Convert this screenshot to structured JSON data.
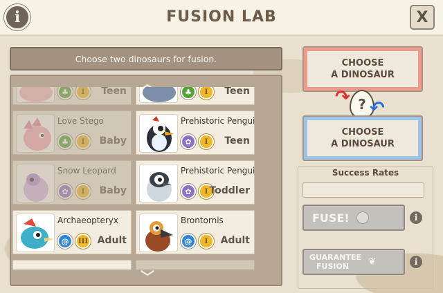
{
  "header": {
    "title": "FUSION LAB",
    "info_icon": "i",
    "close_label": "X"
  },
  "instruction": "Choose two dinosaurs for fusion.",
  "colors": {
    "stage_gold": "#f0b828",
    "choose_red": "#ee9a8f",
    "choose_blue": "#9bc6ea"
  },
  "dino_list": {
    "scroll_up_icon": "chevron-up-icon",
    "scroll_down_icon": "chevron-down-icon",
    "items": [
      {
        "name": "",
        "stage": "Teen",
        "rarity": "I",
        "type": "grass",
        "dimmed": true
      },
      {
        "name": "",
        "stage": "Teen",
        "rarity": "I",
        "type": "grass",
        "dimmed": false
      },
      {
        "name": "Love Stego",
        "stage": "Baby",
        "rarity": "I",
        "type": "grass",
        "dimmed": true
      },
      {
        "name": "Prehistoric Penguin",
        "stage": "Teen",
        "rarity": "I",
        "type": "light",
        "dimmed": false
      },
      {
        "name": "Snow Leopard",
        "stage": "Baby",
        "rarity": "I",
        "type": "light",
        "dimmed": true
      },
      {
        "name": "Prehistoric Penguin",
        "stage": "Toddler",
        "rarity": "I",
        "type": "light",
        "dimmed": false
      },
      {
        "name": "Archaeopteryx",
        "stage": "Adult",
        "rarity": "III",
        "type": "wind",
        "dimmed": false
      },
      {
        "name": "Brontornis",
        "stage": "Adult",
        "rarity": "I",
        "type": "wind",
        "dimmed": false
      }
    ]
  },
  "choose_slots": [
    {
      "line1": "CHOOSE",
      "line2": "A DINOSAUR"
    },
    {
      "line1": "CHOOSE",
      "line2": "A DINOSAUR"
    }
  ],
  "egg_symbol": "?",
  "success_rates": {
    "title": "Success Rates"
  },
  "fuse_button": {
    "label": "FUSE!"
  },
  "guarantee_button": {
    "line1": "GUARANTEE",
    "line2": "FUSION"
  },
  "info_symbol": "i"
}
